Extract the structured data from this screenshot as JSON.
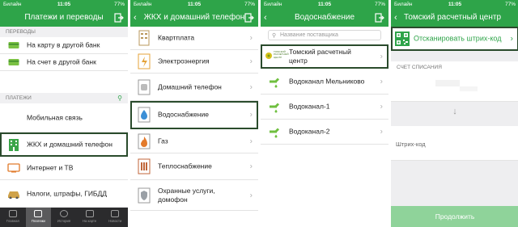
{
  "status": {
    "carrier": "Билайн",
    "time": "11:05",
    "battery": "77%"
  },
  "screen1": {
    "title": "Платежи и переводы",
    "section_transfers": "ПЕРЕВОДЫ",
    "transfer_items": [
      "На карту в другой банк",
      "На счет в другой банк"
    ],
    "section_payments": "ПЛАТЕЖИ",
    "payment_items": [
      "Мобильная связь",
      "ЖКХ и домашний телефон",
      "Интернет и ТВ",
      "Налоги, штрафы, ГИБДД"
    ],
    "tabs": [
      "Главная",
      "Платежи",
      "История",
      "На карте",
      "Новости"
    ]
  },
  "screen2": {
    "title": "ЖКХ и домашний телефон",
    "items": [
      "Квартплата",
      "Электроэнергия",
      "Домашний телефон",
      "Водоснабжение",
      "Газ",
      "Теплоснабжение",
      "Охранные услуги,\nдомофон"
    ]
  },
  "screen3": {
    "title": "Водоснабжение",
    "search_placeholder": "Название поставщика",
    "providers": [
      "Томский расчетный\nцентр",
      "Водоканал Мельниково",
      "Водоканал-1",
      "Водоканал-2"
    ],
    "logo_caption": "ТОМСКИЙ РАСЧЕТНЫЙ ЦЕНТР"
  },
  "screen4": {
    "title": "Томский расчетный центр",
    "scan_label": "Отсканировать штрих-код",
    "account_header": "СЧЕТ СПИСАНИЯ",
    "barcode_label": "Штрих-код",
    "continue_label": "Продолжить"
  },
  "colors": {
    "brand_green": "#2ea449",
    "highlight": "#2a4b2c",
    "disabled_button": "#8fd39a"
  }
}
